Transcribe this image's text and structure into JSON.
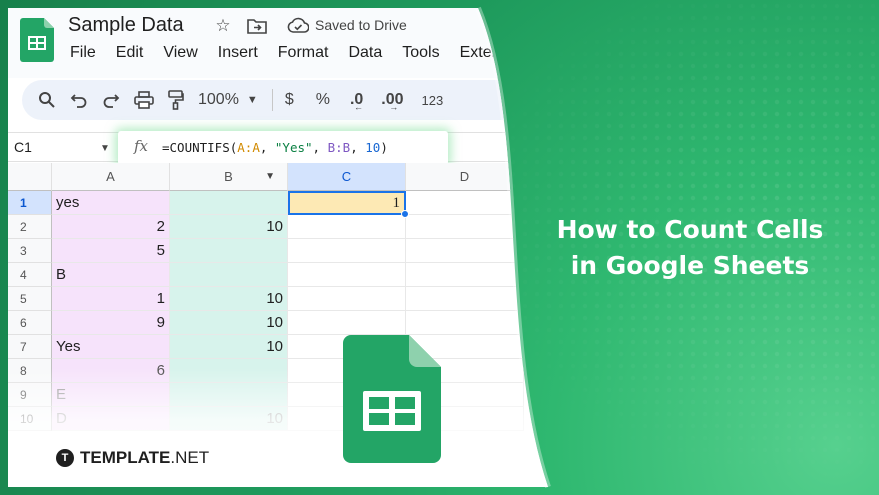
{
  "app": {
    "doc_title": "Sample Data",
    "saved_status": "Saved to Drive",
    "menu": [
      "File",
      "Edit",
      "View",
      "Insert",
      "Format",
      "Data",
      "Tools",
      "Extensio"
    ]
  },
  "toolbar": {
    "zoom": "100%",
    "currency": "$",
    "percent": "%",
    "dec_decrease": ".0",
    "dec_increase": ".00",
    "format_123": "123"
  },
  "formula_bar": {
    "name_box": "C1",
    "fx": "fx",
    "formula_prefix": "=COUNTIFS(",
    "arg1": "A:A",
    "sep1": ", ",
    "arg2": "\"Yes\"",
    "sep2": ", ",
    "arg3": "B:B",
    "sep3": ", ",
    "arg4": "10",
    "formula_suffix": ")"
  },
  "grid": {
    "columns": [
      "A",
      "B",
      "C",
      "D"
    ],
    "rows": [
      {
        "n": "1",
        "a": "yes",
        "b": "",
        "c": "1"
      },
      {
        "n": "2",
        "a": "2",
        "b": "10",
        "c": ""
      },
      {
        "n": "3",
        "a": "5",
        "b": "",
        "c": ""
      },
      {
        "n": "4",
        "a": "B",
        "b": "",
        "c": ""
      },
      {
        "n": "5",
        "a": "1",
        "b": "10",
        "c": ""
      },
      {
        "n": "6",
        "a": "9",
        "b": "10",
        "c": ""
      },
      {
        "n": "7",
        "a": "Yes",
        "b": "10",
        "c": ""
      },
      {
        "n": "8",
        "a": "6",
        "b": "",
        "c": ""
      },
      {
        "n": "9",
        "a": "E",
        "b": "",
        "c": ""
      },
      {
        "n": "10",
        "a": "D",
        "b": "10",
        "c": ""
      }
    ]
  },
  "headline": {
    "line1": "How to Count Cells",
    "line2": "in Google Sheets"
  },
  "brand": {
    "logo_letter": "T",
    "name_bold": "TEMPLATE",
    "name_rest": ".NET"
  },
  "colors": {
    "brand_green": "#1e9a5c",
    "sheets_green": "#23a566",
    "active_cell": "#fde9b4",
    "selection_blue": "#1a73e8"
  }
}
